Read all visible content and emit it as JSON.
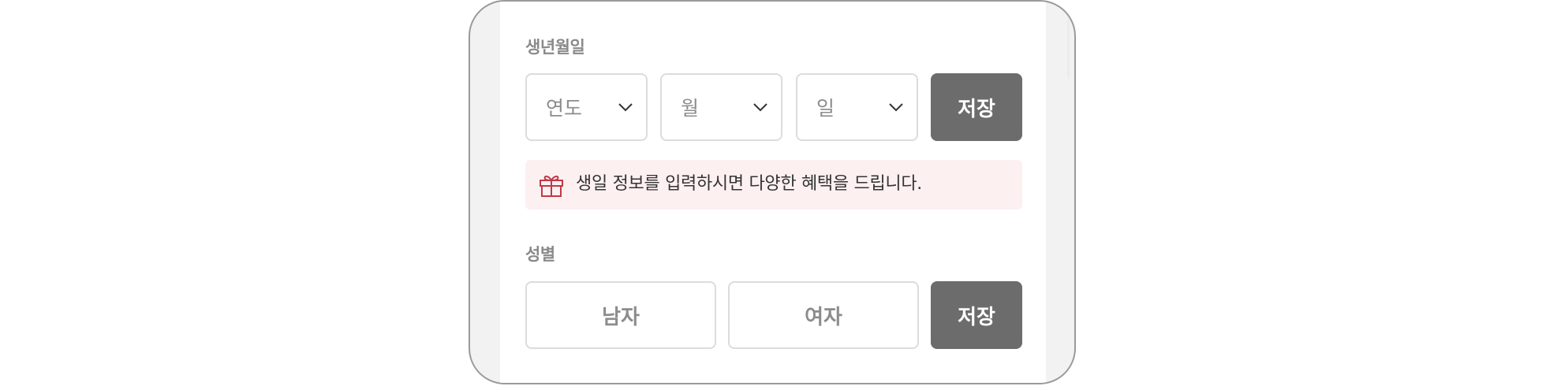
{
  "birthday": {
    "label": "생년월일",
    "year": {
      "value": "연도",
      "icon": "chevron-down-icon"
    },
    "month": {
      "value": "월",
      "icon": "chevron-down-icon"
    },
    "day": {
      "value": "일",
      "icon": "chevron-down-icon"
    },
    "save_label": "저장",
    "notice": {
      "icon": "gift-icon",
      "text": "생일 정보를 입력하시면 다양한 혜택을 드립니다."
    }
  },
  "gender": {
    "label": "성별",
    "options": [
      "남자",
      "여자"
    ],
    "save_label": "저장"
  },
  "colors": {
    "save_button": "#6c6c6c",
    "notice_background": "#fdf0f0",
    "gift_icon": "#c0394a",
    "label_text": "#8a8a8a",
    "border": "#dcdcdc"
  }
}
